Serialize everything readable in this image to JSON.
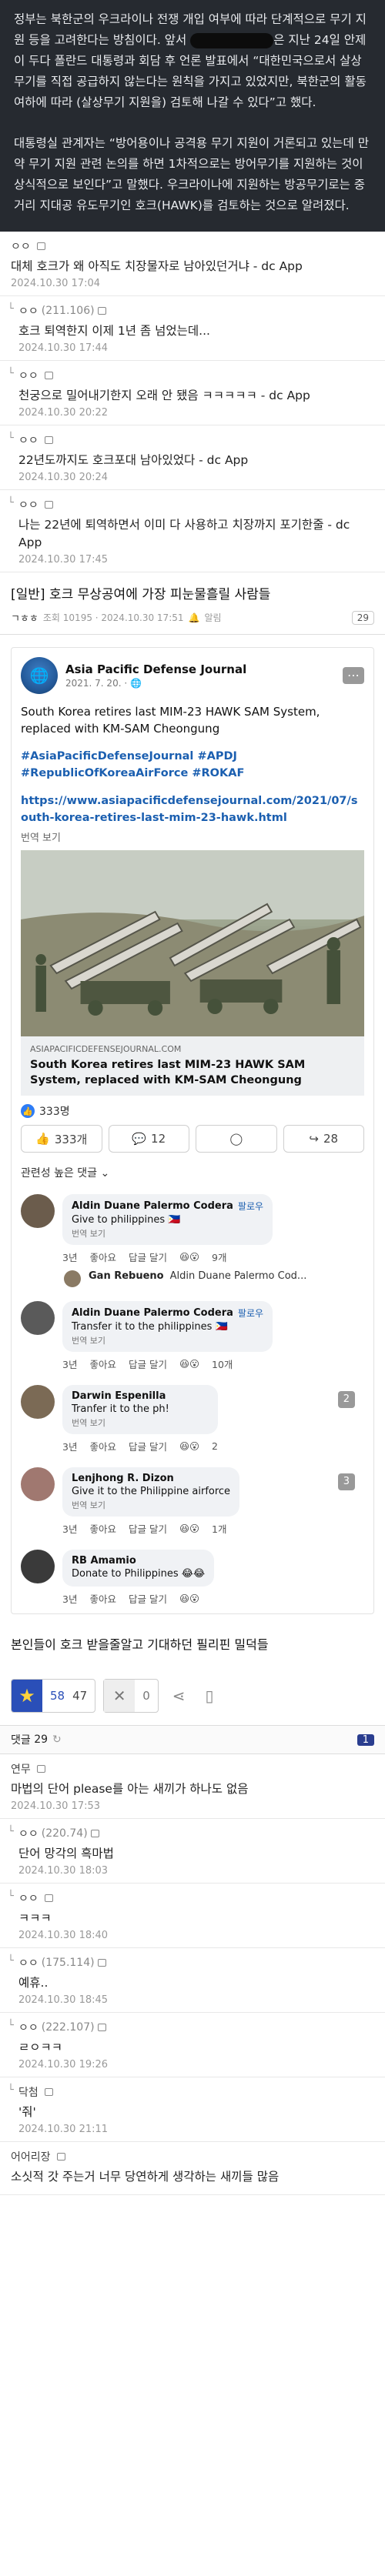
{
  "article": {
    "p1_a": "정부는 북한군의 우크라이나 전쟁 개입 여부에 따라 단계적으로 무기 지원 등을 고려한다는 방침이다. 앞서",
    "p1_b": "은 지난 24일 안제이 두다 폴란드 대통령과 회담 후 언론 발표에서 “대한민국으로서 살상무기를 직접 공급하지 않는다는 원칙을 가지고 있었지만, 북한군의 활동 여하에 따라 (살상무기 지원을) 검토해 나갈 수 있다”고 했다.",
    "p2": "대통령실 관계자는 “방어용이나 공격용 무기 지원이 거론되고 있는데 만약 무기 지원 관련 논의를 하면 1차적으로는 방어무기를 지원하는 것이 상식적으로 보인다”고 말했다. 우크라이나에 지원하는 방공무기로는 중거리 지대공 유도무기인 호크(HAWK)를 검토하는 것으로 알려졌다."
  },
  "comments_top": [
    {
      "nick": "ㅇㅇ",
      "ip": "",
      "text": "대체 호크가 왜 아직도 치장물자로 남아있던거냐 - dc App",
      "date": "2024.10.30 17:04",
      "reply": false
    },
    {
      "nick": "ㅇㅇ",
      "ip": "(211.106)",
      "text": "호크 퇴역한지 이제 1년 좀 넘었는데...",
      "date": "2024.10.30 17:44",
      "reply": true
    },
    {
      "nick": "ㅇㅇ",
      "ip": "",
      "text": "천궁으로 밀어내기한지 오래 안 됐음 ㅋㅋㅋㅋㅋ - dc App",
      "date": "2024.10.30 20:22",
      "reply": true
    },
    {
      "nick": "ㅇㅇ",
      "ip": "",
      "text": "22년도까지도 호크포대 남아있었다 - dc App",
      "date": "2024.10.30 20:24",
      "reply": true
    },
    {
      "nick": "ㅇㅇ",
      "ip": "",
      "text": "나는 22년에 퇴역하면서 이미 다 사용하고 치장까지 포기한줄 - dc App",
      "date": "2024.10.30 17:45",
      "reply": true
    }
  ],
  "post": {
    "title": "[일반] 호크 무상공여에 가장 피눈물흘릴 사람들",
    "author": "ㄱㅎㅎ",
    "meta": "조회 10195 · 2024.10.30 17:51",
    "meta2": "알림",
    "count": "29"
  },
  "fb": {
    "page_name": "Asia Pacific Defense Journal",
    "date": "2021. 7. 20. · 🌐",
    "avatar_glyph": "🌐",
    "text": "South Korea retires last MIM-23 HAWK SAM System, replaced with KM-SAM Cheongung",
    "tags": "#AsiaPacificDefenseJournal #APDJ #RepublicOfKoreaAirForce #ROKAF",
    "link": "https://www.asiapacificdefensejournal.com/2021/07/south-korea-retires-last-mim-23-hawk.html",
    "translate": "번역 보기",
    "card_domain": "ASIAPACIFICDEFENSEJOURNAL.COM",
    "card_title": "South Korea retires last MIM-23 HAWK SAM System, replaced with KM-SAM Cheongung",
    "reaction_count": "333명",
    "like_btn": "333개",
    "comment_btn": "12",
    "share_btn": "28",
    "relevance": "관련성 높은 댓글 ⌄",
    "comments": [
      {
        "name": "Aldin Duane Palermo Codera",
        "follow": "팔로우",
        "text": "Give to philippines 🇵🇭",
        "tr": "번역 보기",
        "time": "3년",
        "like": "좋아요",
        "reply": "답글 달기",
        "react": "9개",
        "badge": ""
      },
      {
        "name": "Gan Rebueno",
        "follow": "",
        "text": "Aldin Duane Palermo Cod...",
        "tr": "",
        "time": "",
        "like": "",
        "reply": "",
        "react": "",
        "badge": ""
      },
      {
        "name": "Aldin Duane Palermo Codera",
        "follow": "팔로우",
        "text": "Transfer it to the philippines 🇵🇭",
        "tr": "번역 보기",
        "time": "3년",
        "like": "좋아요",
        "reply": "답글 달기",
        "react": "10개",
        "badge": ""
      },
      {
        "name": "Darwin Espenilla",
        "follow": "",
        "text": "Tranfer it to the ph!",
        "tr": "번역 보기",
        "time": "3년",
        "like": "좋아요",
        "reply": "답글 달기",
        "react": "2",
        "badge": "2"
      },
      {
        "name": "Lenjhong R. Dizon",
        "follow": "",
        "text": "Give it to the Philippine airforce",
        "tr": "번역 보기",
        "time": "3년",
        "like": "좋아요",
        "reply": "답글 달기",
        "react": "1개",
        "badge": "3"
      },
      {
        "name": "RB Amamio",
        "follow": "",
        "text": "Donate to Philippines 😂😂",
        "tr": "",
        "time": "3년",
        "like": "좋아요",
        "reply": "답글 달기",
        "react": "",
        "badge": ""
      }
    ]
  },
  "post_bottom": "본인들이 호크 받을줄알고 기대하던 필리핀 밀덕들",
  "votes": {
    "up": "58",
    "fixed": "47",
    "down": "0"
  },
  "comment_header": {
    "label": "댓글",
    "count": "29",
    "page": "1"
  },
  "comments_bottom": [
    {
      "nick": "연무",
      "ip": "",
      "text": "마법의 단어 please를 아는 새끼가 하나도 없음",
      "date": "2024.10.30 17:53",
      "reply": false
    },
    {
      "nick": "ㅇㅇ",
      "ip": "(220.74)",
      "text": "단어 망각의 흑마법",
      "date": "2024.10.30 18:03",
      "reply": true
    },
    {
      "nick": "ㅇㅇ",
      "ip": "",
      "text": "ㅋㅋㅋ",
      "date": "2024.10.30 18:40",
      "reply": true
    },
    {
      "nick": "ㅇㅇ",
      "ip": "(175.114)",
      "text": "예휴..",
      "date": "2024.10.30 18:45",
      "reply": true
    },
    {
      "nick": "ㅇㅇ",
      "ip": "(222.107)",
      "text": "ㄹㅇㅋㅋ",
      "date": "2024.10.30 19:26",
      "reply": true
    },
    {
      "nick": "닥첨",
      "ip": "",
      "text": "'줘'",
      "date": "2024.10.30 21:11",
      "reply": true
    },
    {
      "nick": "어어리장",
      "ip": "",
      "text": "소싯적 갓 주는거 너무 당연하게 생각하는 새끼들 많음",
      "date": "",
      "reply": false
    }
  ]
}
